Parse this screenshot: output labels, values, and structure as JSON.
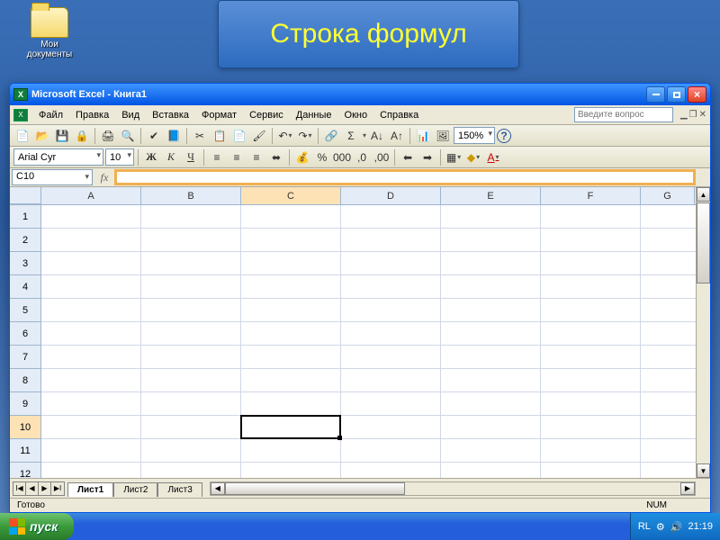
{
  "desktop": {
    "myDocs": "Мои документы"
  },
  "banner": "Строка формул",
  "window": {
    "title": "Microsoft Excel - Книга1"
  },
  "menu": {
    "file": "Файл",
    "edit": "Правка",
    "view": "Вид",
    "insert": "Вставка",
    "format": "Формат",
    "tools": "Сервис",
    "data": "Данные",
    "window": "Окно",
    "help": "Справка",
    "searchPlaceholder": "Введите вопрос"
  },
  "font": {
    "name": "Arial Cyr",
    "size": "10"
  },
  "zoom": "150%",
  "formatLabels": {
    "bold": "Ж",
    "italic": "К",
    "underline": "Ч"
  },
  "namebox": "C10",
  "formula": "",
  "columns": [
    "A",
    "B",
    "C",
    "D",
    "E",
    "F",
    "G"
  ],
  "rows": [
    "1",
    "2",
    "3",
    "4",
    "5",
    "6",
    "7",
    "8",
    "9",
    "10",
    "11",
    "12"
  ],
  "activeCell": {
    "col": "C",
    "row": "10"
  },
  "sheets": {
    "s1": "Лист1",
    "s2": "Лист2",
    "s3": "Лист3"
  },
  "status": {
    "ready": "Готово",
    "num": "NUM"
  },
  "taskbar": {
    "start": "пуск",
    "lang": "RL",
    "time": "21:19"
  },
  "icons": {
    "autosum": "Σ",
    "percent": "%",
    "currency": "%",
    "help": "?",
    "decimals1": ",0",
    "decimals2": ",00",
    "thousands": "000"
  }
}
